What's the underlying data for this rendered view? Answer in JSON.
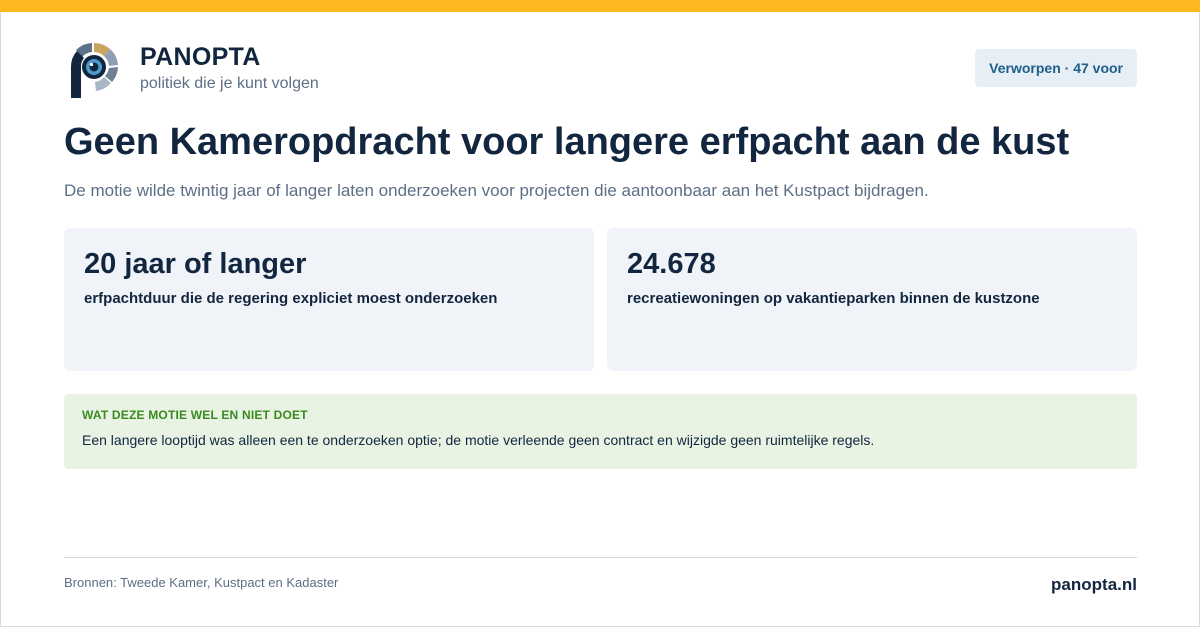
{
  "brand": {
    "name": "PANOPTA",
    "tagline": "politiek die je kunt volgen",
    "logo_icon": "eye-aperture-p-logo-icon"
  },
  "status": {
    "label": "Verworpen · 47 voor"
  },
  "headline": {
    "title": "Geen Kameropdracht voor langere erfpacht aan de kust",
    "subtitle": "De motie wilde twintig jaar of langer laten onderzoeken voor projecten die aantoonbaar aan het Kustpact bijdragen."
  },
  "stats": [
    {
      "value": "20 jaar of langer",
      "label": "erfpachtduur die de regering expliciet moest onderzoeken"
    },
    {
      "value": "24.678",
      "label": "recreatiewoningen op vakantieparken binnen de kustzone"
    }
  ],
  "notice": {
    "heading": "WAT DEZE MOTIE WEL EN NIET DOET",
    "text": "Een langere looptijd was alleen een te onderzoeken optie; de motie verleende geen contract en wijzigde geen ruimtelijke regels."
  },
  "footer": {
    "sources": "Bronnen: Tweede Kamer, Kustpact en Kadaster",
    "site": "panopta.nl"
  },
  "colors": {
    "accent_bar": "#fbb81f",
    "navy": "#12263f",
    "badge_bg": "#e6eef6",
    "notice_bg": "#e8f3e4",
    "notice_heading": "#3a8a1f"
  }
}
